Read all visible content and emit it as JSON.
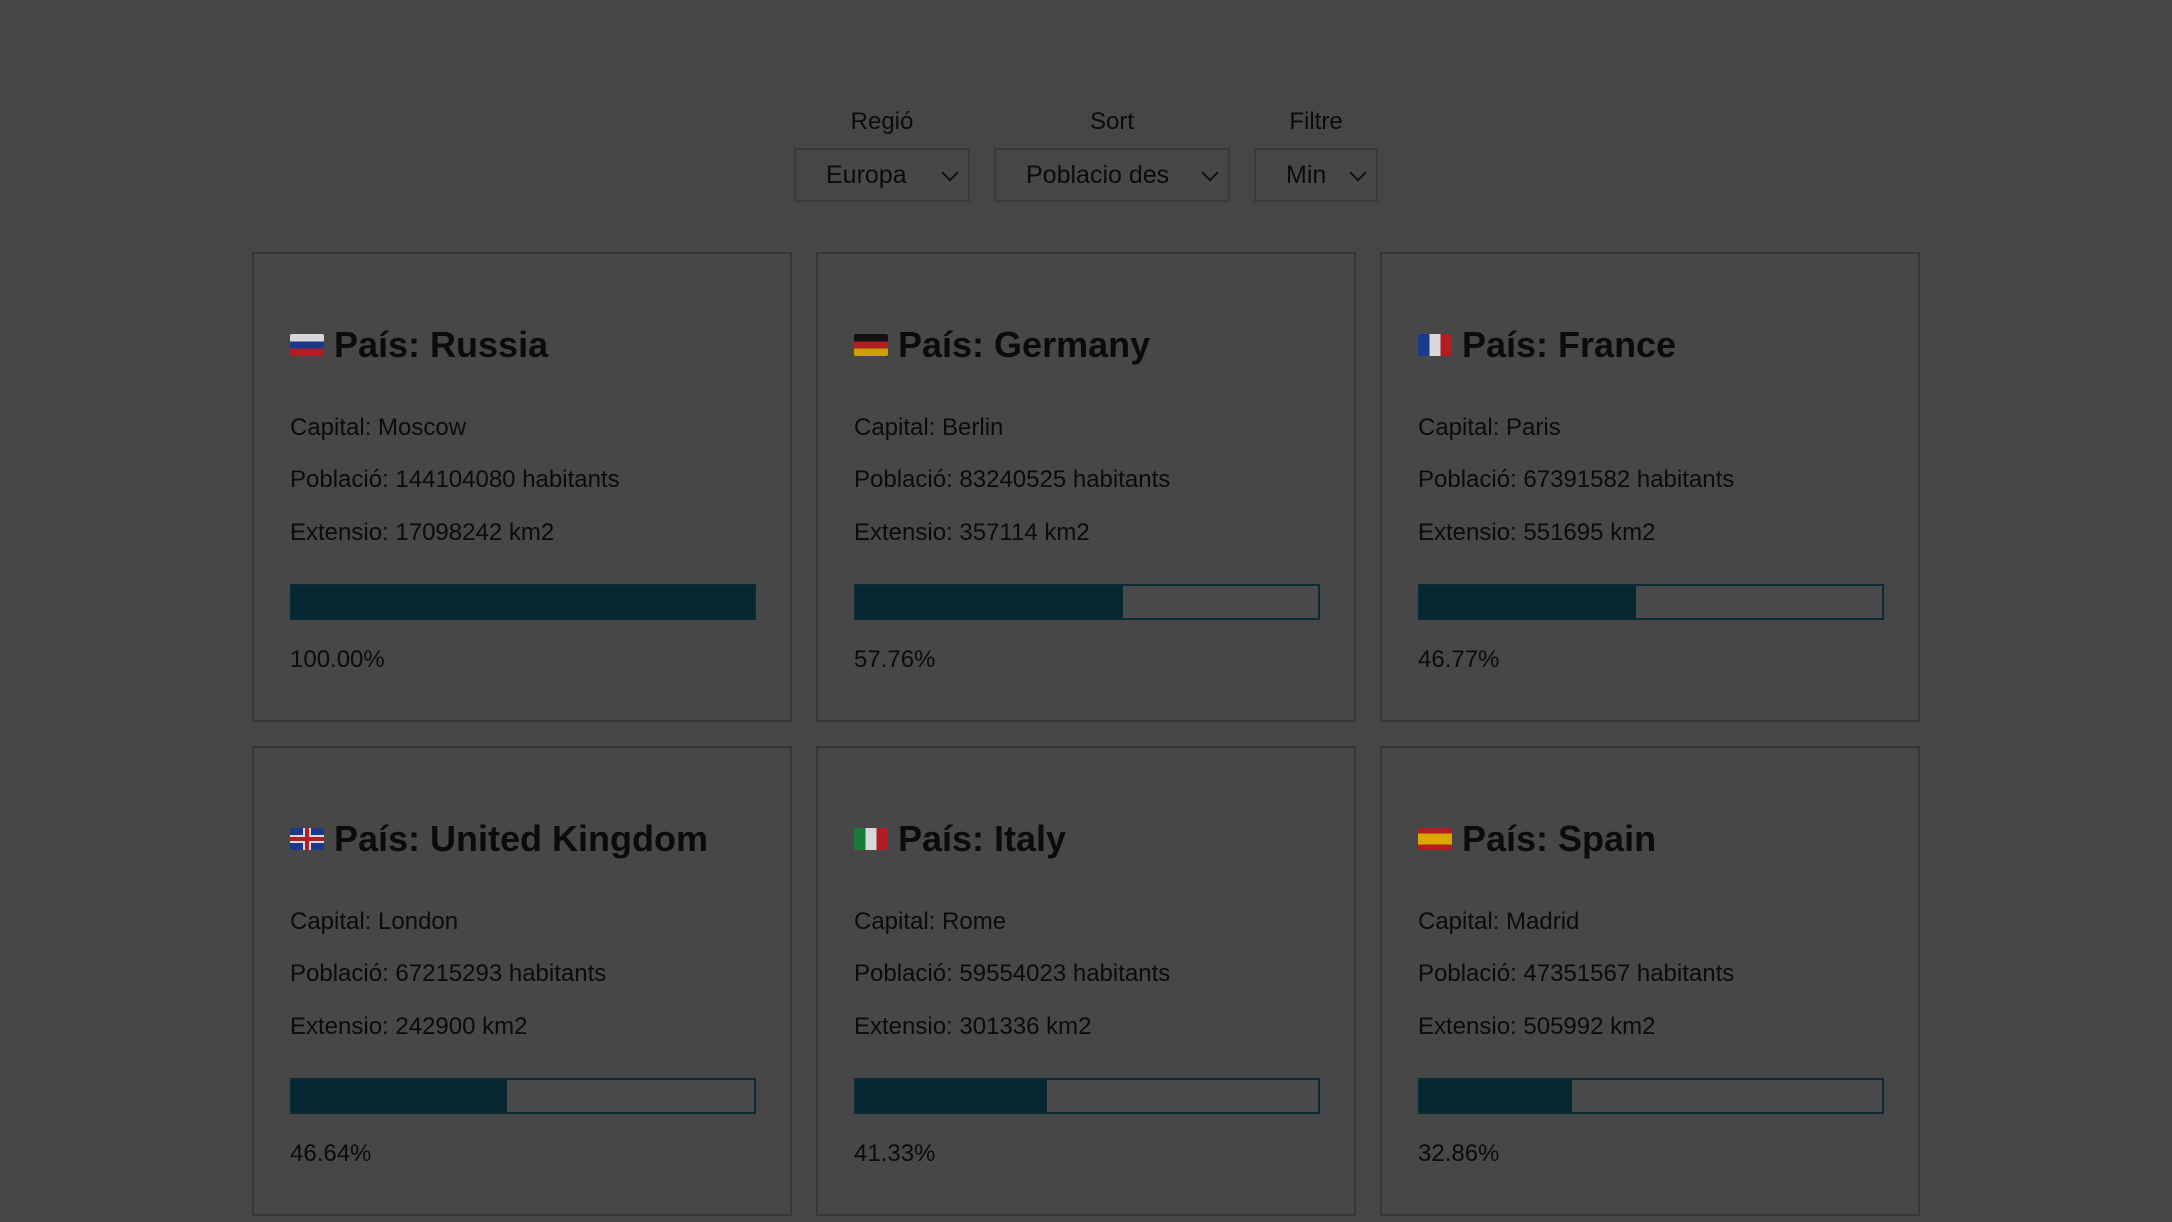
{
  "filters": {
    "region": {
      "label": "Regió",
      "value": "Europa"
    },
    "sort": {
      "label": "Sort",
      "value": "Poblacio des"
    },
    "filter": {
      "label": "Filtre",
      "value": "Min"
    }
  },
  "cards": [
    {
      "title": "País: Russia",
      "flag": "flag-russia",
      "capital": "Capital: Moscow",
      "population": "Població: 144104080 habitants",
      "extension": "Extensio: 17098242 km2",
      "percent_text": "100.00%",
      "percent": 100.0,
      "flag_colors": [
        "#d8d8d8",
        "#1c3a8c",
        "#b11d22"
      ]
    },
    {
      "title": "País: Germany",
      "flag": "flag-germany",
      "capital": "Capital: Berlin",
      "population": "Població: 83240525 habitants",
      "extension": "Extensio: 357114 km2",
      "percent_text": "57.76%",
      "percent": 57.76,
      "flag_colors": [
        "#111111",
        "#b11d22",
        "#c9a100"
      ]
    },
    {
      "title": "País: France",
      "flag": "flag-france",
      "capital": "Capital: Paris",
      "population": "Població: 67391582 habitants",
      "extension": "Extensio: 551695 km2",
      "percent_text": "46.77%",
      "percent": 46.77,
      "flag_colors": [
        "#1c3a8c",
        "#d8d8d8",
        "#b11d22"
      ]
    },
    {
      "title": "País: United Kingdom",
      "flag": "flag-united-kingdom",
      "capital": "Capital: London",
      "population": "Població: 67215293 habitants",
      "extension": "Extensio: 242900 km2",
      "percent_text": "46.64%",
      "percent": 46.64,
      "flag_colors": [
        "#1c3a8c",
        "#d8d8d8",
        "#b11d22"
      ]
    },
    {
      "title": "País: Italy",
      "flag": "flag-italy",
      "capital": "Capital: Rome",
      "population": "Població: 59554023 habitants",
      "extension": "Extensio: 301336 km2",
      "percent_text": "41.33%",
      "percent": 41.33,
      "flag_colors": [
        "#1b7a3a",
        "#d8d8d8",
        "#b11d22"
      ]
    },
    {
      "title": "País: Spain",
      "flag": "flag-spain",
      "capital": "Capital: Madrid",
      "population": "Població: 47351567 habitants",
      "extension": "Extensio: 505992 km2",
      "percent_text": "32.86%",
      "percent": 32.86,
      "flag_colors": [
        "#b11d22",
        "#d9a900",
        "#b11d22"
      ]
    }
  ],
  "colors": {
    "bar_fill": "#062730",
    "overlay_background": "#464646"
  }
}
